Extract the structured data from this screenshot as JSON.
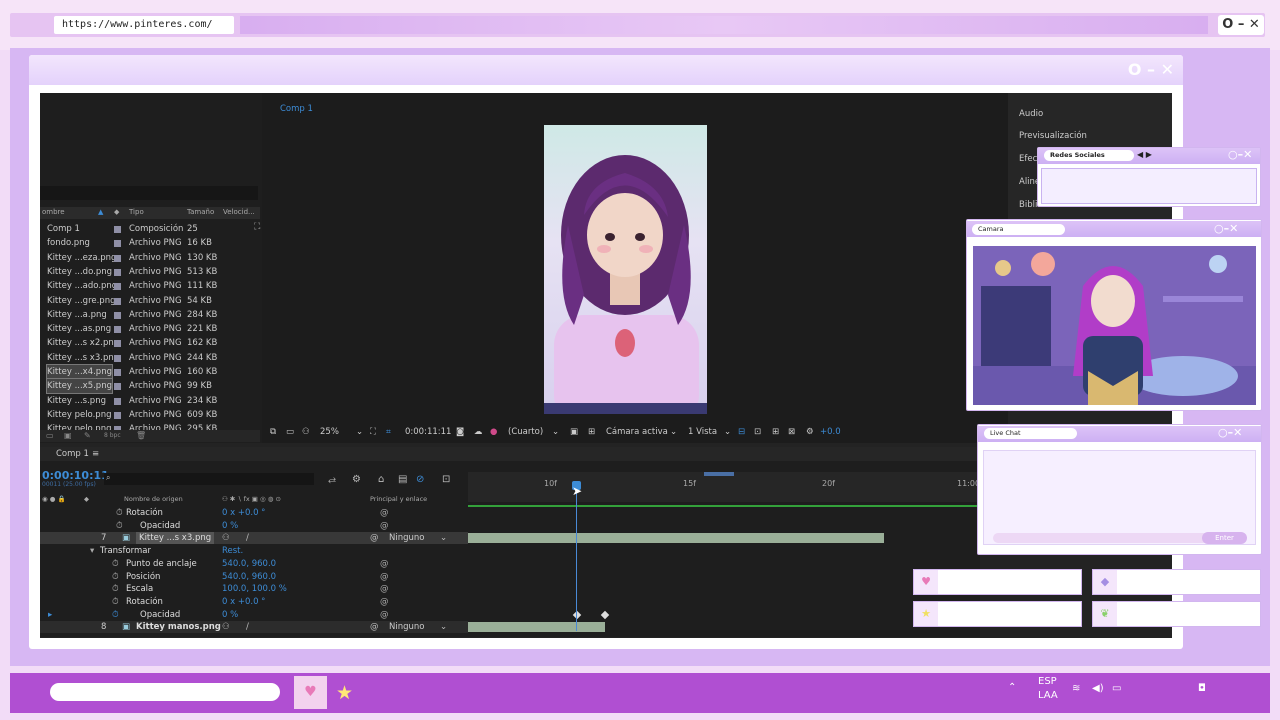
{
  "browser": {
    "url": "https://www.pinteres.com/",
    "controls": "O – ✕"
  },
  "window": {
    "controls": "O – ✕"
  },
  "project": {
    "headers": {
      "name": "ombre",
      "type": "Tipo",
      "size": "Tamaño",
      "speed": "Velocid..."
    },
    "rows": [
      {
        "name": "Comp 1",
        "type": "Composición",
        "size": "25"
      },
      {
        "name": "fondo.png",
        "type": "Archivo PNG",
        "size": "16 KB"
      },
      {
        "name": "Kittey ...eza.png",
        "type": "Archivo PNG",
        "size": "130 KB"
      },
      {
        "name": "Kittey ...do.png",
        "type": "Archivo PNG",
        "size": "513 KB"
      },
      {
        "name": "Kittey ...ado.png",
        "type": "Archivo PNG",
        "size": "111 KB"
      },
      {
        "name": "Kittey ...gre.png",
        "type": "Archivo PNG",
        "size": "54 KB"
      },
      {
        "name": "Kittey ...a.png",
        "type": "Archivo PNG",
        "size": "284 KB"
      },
      {
        "name": "Kittey ...as.png",
        "type": "Archivo PNG",
        "size": "221 KB"
      },
      {
        "name": "Kittey ...s x2.png",
        "type": "Archivo PNG",
        "size": "162 KB"
      },
      {
        "name": "Kittey ...s x3.png",
        "type": "Archivo PNG",
        "size": "244 KB"
      },
      {
        "name": "Kittey ...x4.png",
        "type": "Archivo PNG",
        "size": "160 KB"
      },
      {
        "name": "Kittey ...x5.png",
        "type": "Archivo PNG",
        "size": "99 KB"
      },
      {
        "name": "Kittey ...s.png",
        "type": "Archivo PNG",
        "size": "234 KB"
      },
      {
        "name": "Kittey pelo.png",
        "type": "Archivo PNG",
        "size": "609 KB"
      },
      {
        "name": "Kittey pelo.png",
        "type": "Archivo PNG",
        "size": "295 KB"
      }
    ],
    "bpc": "8 bpc"
  },
  "viewer": {
    "tab": "Comp 1",
    "zoom": "25%",
    "timecode": "0:00:11:11",
    "quality": "(Cuarto)",
    "camera": "Cámara activa",
    "views": "1 Vista",
    "exposure": "+0.0"
  },
  "right_panel": [
    "Audio",
    "Previsualización",
    "Efectos",
    "Alineación",
    "Bibliotecas"
  ],
  "timeline": {
    "tab": "Comp 1",
    "timecode": "0:00:10:11",
    "fps": "00011 (25.00 fps)",
    "columns": {
      "source": "Nombre de origen",
      "parent": "Principal y enlace"
    },
    "ruler": [
      "10f",
      "15f",
      "20f",
      "11:00"
    ],
    "rows": [
      {
        "label": "Rotación",
        "value": "0 x +0.0 °"
      },
      {
        "label": "Opacidad",
        "value": "0 %"
      },
      {
        "num": "7",
        "label": "Kittey ...s x3.png",
        "parent": "Ninguno"
      },
      {
        "label": "Transformar",
        "value": "Rest."
      },
      {
        "label": "Punto de anclaje",
        "value": "540.0, 960.0"
      },
      {
        "label": "Posición",
        "value": "540.0, 960.0"
      },
      {
        "label": "Escala",
        "value": "100.0, 100.0 %"
      },
      {
        "label": "Rotación",
        "value": "0 x +0.0 °"
      },
      {
        "label": "Opacidad",
        "value": "0 %"
      },
      {
        "num": "8",
        "label": "Kittey manos.png",
        "parent": "Ninguno"
      }
    ]
  },
  "widgets": {
    "redes": {
      "title": "Redes Sociales"
    },
    "camara": {
      "title": "Camara"
    },
    "chat": {
      "title": "Live Chat",
      "enter": "Enter"
    }
  },
  "taskbar": {
    "lang1": "ESP",
    "lang2": "LAA"
  },
  "colors": {
    "accent": "#b04fd2",
    "ae_blue": "#3d8cd6",
    "frame": "#d7b7f3"
  }
}
